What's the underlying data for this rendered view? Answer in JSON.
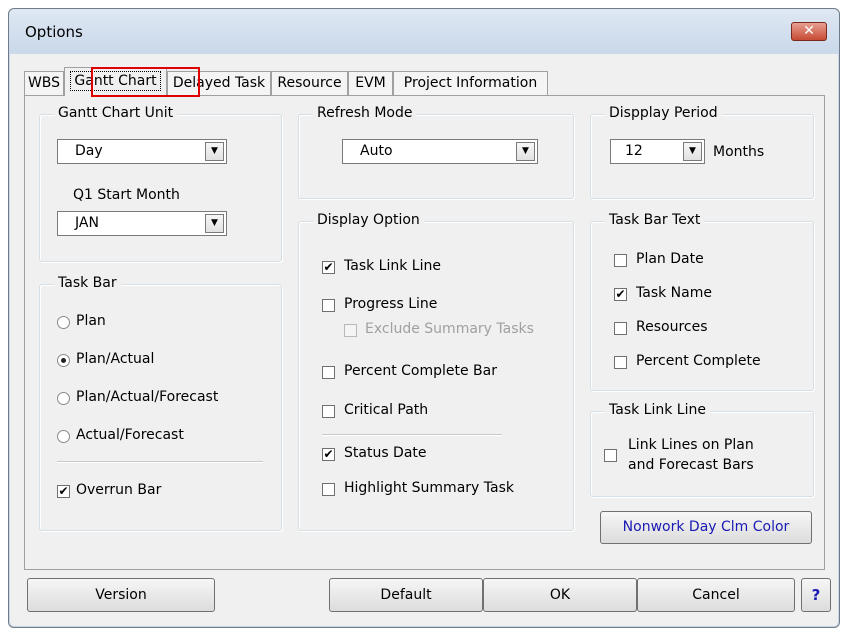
{
  "window": {
    "title": "Options",
    "close_glyph": "✕"
  },
  "tabs": [
    {
      "label": "WBS"
    },
    {
      "label": "Gantt Chart"
    },
    {
      "label": "Delayed Task"
    },
    {
      "label": "Resource"
    },
    {
      "label": "EVM"
    },
    {
      "label": "Project Information"
    }
  ],
  "active_tab": "Gantt Chart",
  "gantt_unit": {
    "title": "Gantt Chart Unit",
    "unit_value": "Day",
    "q1_label": "Q1 Start Month",
    "q1_value": "JAN"
  },
  "refresh_mode": {
    "title": "Refresh Mode",
    "value": "Auto"
  },
  "display_period": {
    "title": "Dispplay Period",
    "value": "12",
    "unit_label": "Months"
  },
  "task_bar": {
    "title": "Task Bar",
    "options": [
      {
        "label": "Plan",
        "selected": false
      },
      {
        "label": "Plan/Actual",
        "selected": true
      },
      {
        "label": "Plan/Actual/Forecast",
        "selected": false
      },
      {
        "label": "Actual/Forecast",
        "selected": false
      }
    ],
    "overrun_label": "Overrun Bar",
    "overrun_checked": true
  },
  "display_option": {
    "title": "Display Option",
    "task_link_line": {
      "label": "Task Link Line",
      "checked": true
    },
    "progress_line": {
      "label": "Progress Line",
      "checked": false
    },
    "exclude_summary": {
      "label": "Exclude Summary Tasks",
      "checked": false,
      "enabled": false
    },
    "percent_complete_bar": {
      "label": "Percent Complete Bar",
      "checked": false
    },
    "critical_path": {
      "label": "Critical Path",
      "checked": false
    },
    "status_date": {
      "label": "Status Date",
      "checked": true
    },
    "highlight_summary": {
      "label": "Highlight Summary Task",
      "checked": false
    }
  },
  "task_bar_text": {
    "title": "Task Bar Text",
    "items": [
      {
        "label": "Plan Date",
        "checked": false
      },
      {
        "label": "Task Name",
        "checked": true
      },
      {
        "label": "Resources",
        "checked": false
      },
      {
        "label": "Percent Complete",
        "checked": false
      }
    ]
  },
  "task_link_line": {
    "title": "Task Link Line",
    "label_line1": "Link Lines on Plan",
    "label_line2": "and Forecast Bars",
    "checked": false
  },
  "nonwork_button": "Nonwork Day Clm Color",
  "buttons": {
    "version": "Version",
    "default": "Default",
    "ok": "OK",
    "cancel": "Cancel",
    "help": "?"
  },
  "glyphs": {
    "check": "✔",
    "dropdown": "▼"
  },
  "colors": {
    "highlight_box": "#e00000",
    "link_text": "#1a1ab4",
    "close_button": "#c74a33"
  }
}
